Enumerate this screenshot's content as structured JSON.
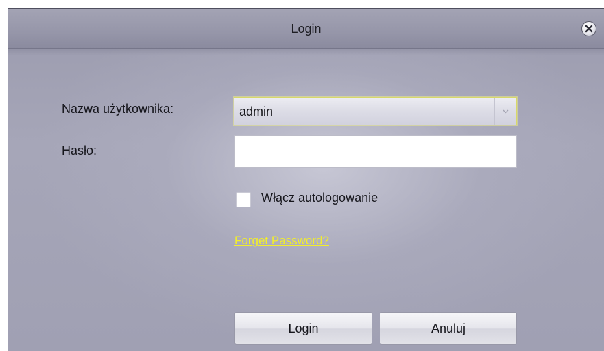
{
  "window": {
    "title": "Login",
    "close_icon": "close-icon"
  },
  "form": {
    "username_label": "Nazwa użytkownika:",
    "username_value": "admin",
    "password_label": "Hasło:",
    "password_value": "",
    "autologin_label": "Włącz autologowanie",
    "autologin_checked": false,
    "forgot_link": "Forget Password?"
  },
  "buttons": {
    "login": "Login",
    "cancel": "Anuluj"
  },
  "colors": {
    "link": "#f2ee2c",
    "combo_focus_border": "#d8d86a"
  }
}
